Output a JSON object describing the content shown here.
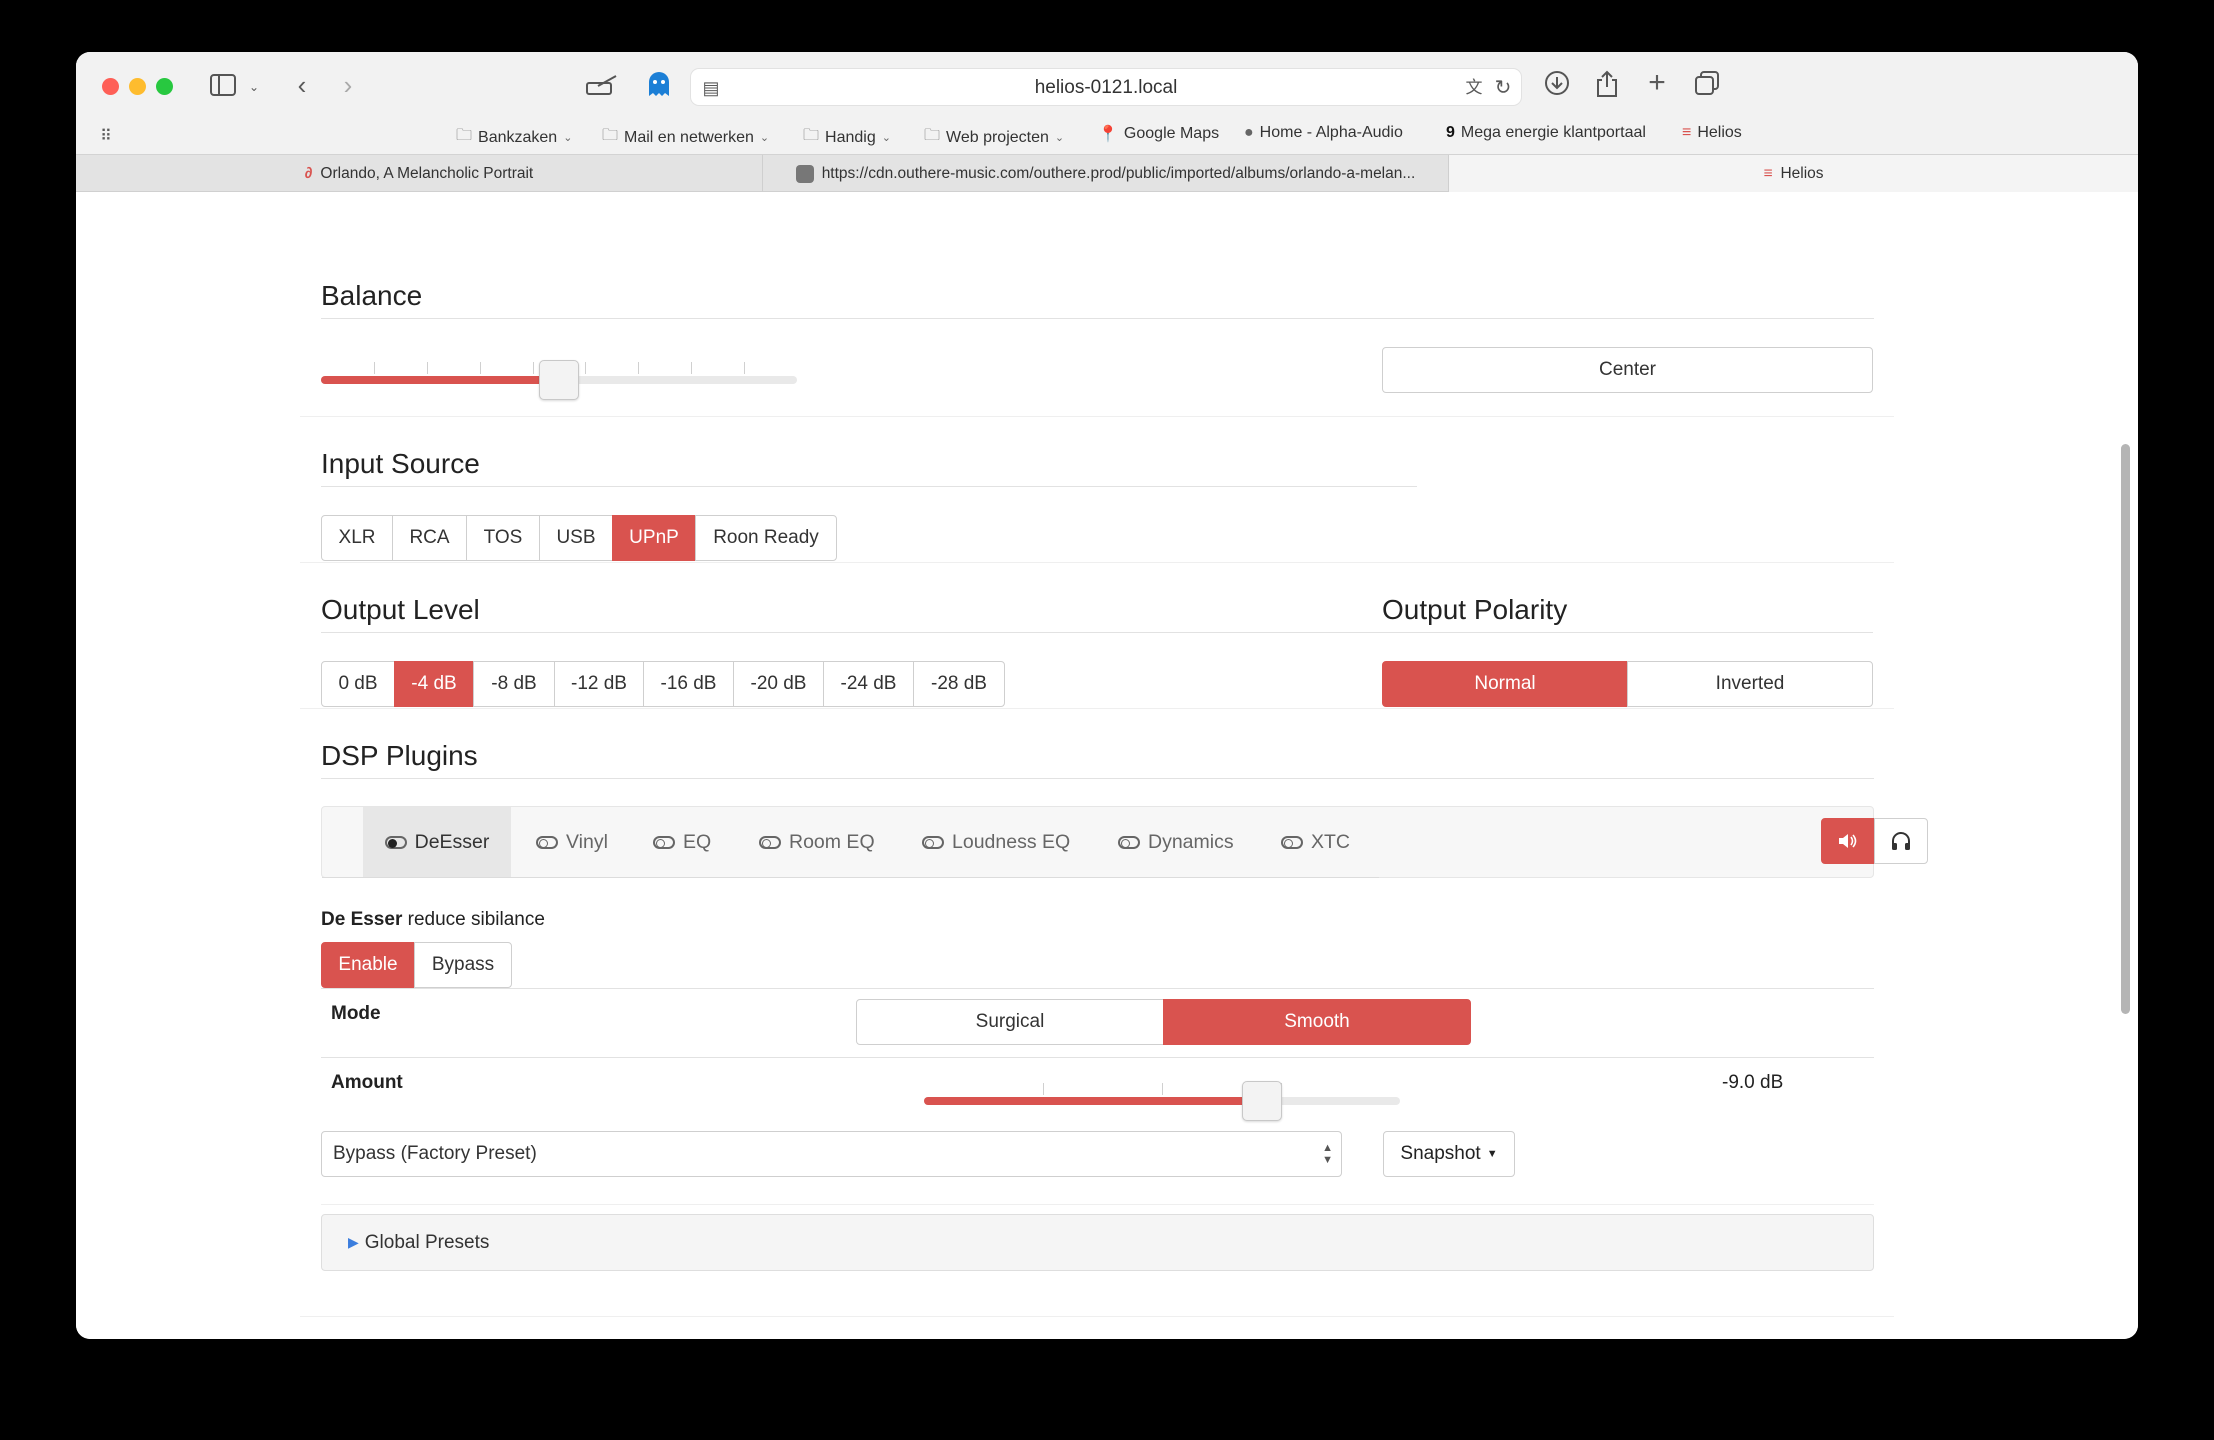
{
  "browser": {
    "url": "helios-0121.local",
    "bookmarks": [
      {
        "label": "Bankzaken",
        "icon": "folder-icon",
        "dropdown": true
      },
      {
        "label": "Mail en netwerken",
        "icon": "folder-icon",
        "dropdown": true
      },
      {
        "label": "Handig",
        "icon": "folder-icon",
        "dropdown": true
      },
      {
        "label": "Web projecten",
        "icon": "folder-icon",
        "dropdown": true
      },
      {
        "label": "Google Maps",
        "icon": "map-pin-icon",
        "dropdown": false
      },
      {
        "label": "Home - Alpha-Audio",
        "icon": "site-icon",
        "dropdown": false
      },
      {
        "label": "Mega energie klantportaal",
        "icon": "site-icon",
        "dropdown": false
      },
      {
        "label": "Helios",
        "icon": "site-icon",
        "dropdown": false
      }
    ],
    "tabs": [
      {
        "label": "Orlando, A Melancholic Portrait",
        "active": false
      },
      {
        "label": "https://cdn.outhere-music.com/outhere.prod/public/imported/albums/orlando-a-melan...",
        "active": false
      },
      {
        "label": "Helios",
        "active": true
      }
    ]
  },
  "balance": {
    "title": "Balance",
    "value_fraction": 0.5,
    "center_label": "Center"
  },
  "input_source": {
    "title": "Input Source",
    "options": [
      "XLR",
      "RCA",
      "TOS",
      "USB",
      "UPnP",
      "Roon Ready"
    ],
    "selected": "UPnP"
  },
  "output_level": {
    "title": "Output Level",
    "options": [
      "0 dB",
      "-4 dB",
      "-8 dB",
      "-12 dB",
      "-16 dB",
      "-20 dB",
      "-24 dB",
      "-28 dB"
    ],
    "selected": "-4 dB"
  },
  "output_polarity": {
    "title": "Output Polarity",
    "options": [
      "Normal",
      "Inverted"
    ],
    "selected": "Normal"
  },
  "dsp": {
    "title": "DSP Plugins",
    "plugins": [
      "DeEsser",
      "Vinyl",
      "EQ",
      "Room EQ",
      "Loudness EQ",
      "Dynamics",
      "XTC"
    ],
    "selected": "DeEsser",
    "output_modes": {
      "speaker": "speaker-icon",
      "headphones": "headphones-icon",
      "selected": "speaker"
    }
  },
  "deesser": {
    "name": "De Esser",
    "description": "reduce sibilance",
    "enable_label": "Enable",
    "bypass_label": "Bypass",
    "state": "Enable",
    "mode_label": "Mode",
    "mode_options": [
      "Surgical",
      "Smooth"
    ],
    "mode_selected": "Smooth",
    "amount_label": "Amount",
    "amount_value": "-9.0 dB",
    "amount_fraction": 0.71
  },
  "preset": {
    "selected": "Bypass (Factory Preset)",
    "snapshot_label": "Snapshot"
  },
  "global_presets": {
    "label": "Global Presets"
  },
  "colors": {
    "accent": "#d9534f"
  }
}
